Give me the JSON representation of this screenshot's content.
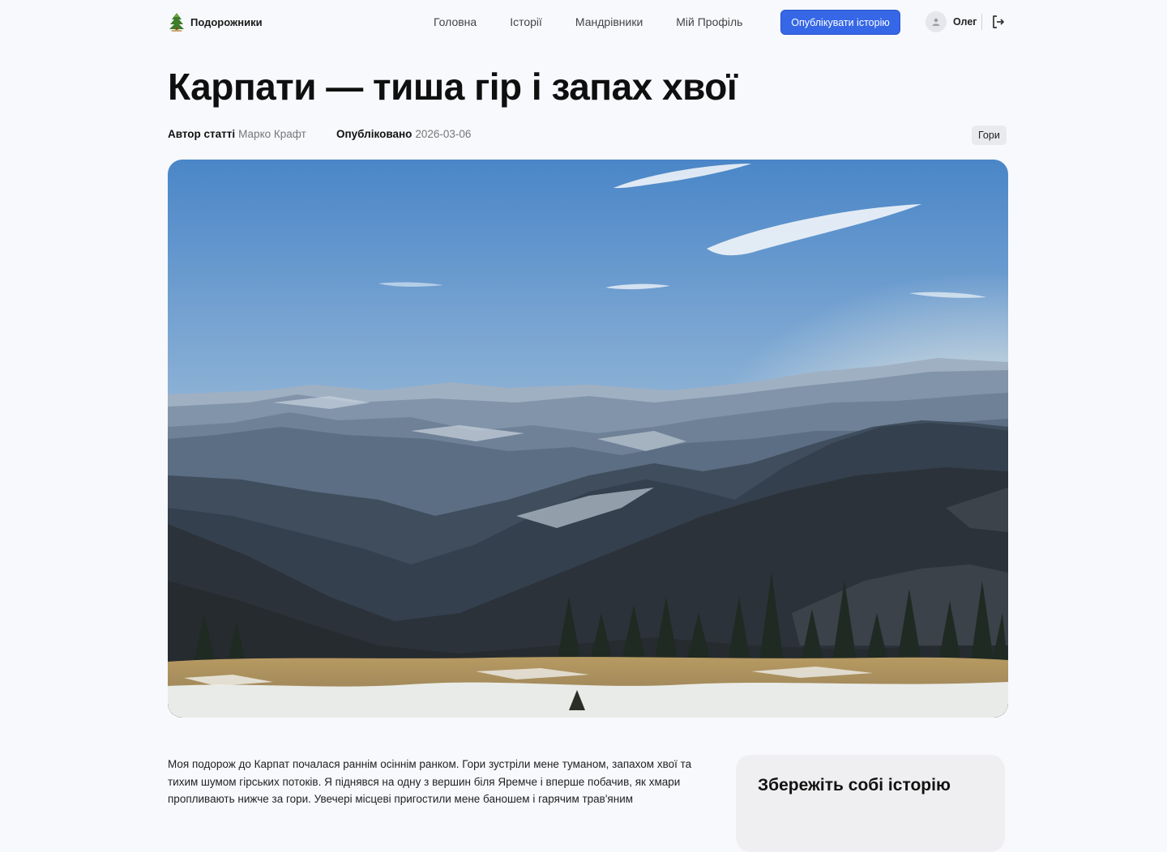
{
  "brand": {
    "name": "Подорожники"
  },
  "nav": {
    "items": [
      "Головна",
      "Історії",
      "Мандрівники",
      "Мій Профіль"
    ],
    "publish_label": "Опублікувати історію"
  },
  "user": {
    "name": "Олег"
  },
  "article": {
    "title": "Карпати — тиша гір і запах хвої",
    "author_label": "Автор статті",
    "author": "Марко Крафт",
    "published_label": "Опубліковано",
    "date": "2026-03-06",
    "tag": "Гори",
    "body": "Моя подорож до Карпат почалася раннім осіннім ранком. Гори зустріли мене туманом, запахом хвої та тихим шумом гірських потоків. Я піднявся на одну з вершин біля Яремче і вперше побачив, як хмари пропливають нижче за гори. Увечері місцеві пригостили мене банoшем і гарячим трав'яним"
  },
  "sidebar": {
    "save_title": "Збережіть собі історію"
  },
  "icons": {
    "logo": "pine-tree-icon",
    "avatar": "user-icon",
    "logout": "logout-icon"
  },
  "colors": {
    "accent": "#3567e6",
    "background": "#f7f9fc",
    "tag_bg": "#e8eaee"
  }
}
